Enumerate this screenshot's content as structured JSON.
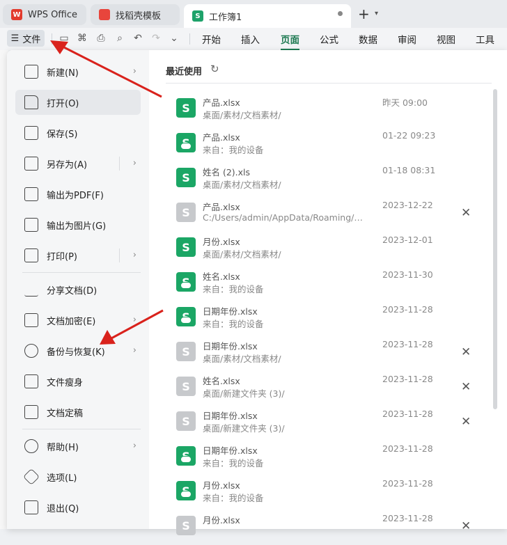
{
  "tabs": [
    {
      "label": "WPS Office",
      "icon": "wps-logo-icon"
    },
    {
      "label": "找稻壳模板",
      "icon": "template-icon"
    },
    {
      "label": "工作簿1",
      "icon": "spreadsheet-s-icon"
    }
  ],
  "toolbar": {
    "file_label": "文件",
    "menus": [
      "开始",
      "插入",
      "页面",
      "公式",
      "数据",
      "审阅",
      "视图",
      "工具"
    ],
    "active_menu": "页面"
  },
  "file_menu": [
    {
      "label": "新建(N)",
      "icon": "new-doc-icon",
      "submenu": true
    },
    {
      "label": "打开(O)",
      "icon": "folder-icon",
      "submenu": false,
      "highlighted": true
    },
    {
      "label": "保存(S)",
      "icon": "save-icon",
      "submenu": false
    },
    {
      "label": "另存为(A)",
      "icon": "save-as-icon",
      "submenu": true
    },
    {
      "label": "输出为PDF(F)",
      "icon": "pdf-icon",
      "submenu": false
    },
    {
      "label": "输出为图片(G)",
      "icon": "image-icon",
      "submenu": false
    },
    {
      "label": "打印(P)",
      "icon": "print-icon",
      "submenu": true
    },
    {
      "label": "分享文档(D)",
      "icon": "share-icon",
      "submenu": false
    },
    {
      "label": "文档加密(E)",
      "icon": "encrypt-icon",
      "submenu": true
    },
    {
      "label": "备份与恢复(K)",
      "icon": "backup-icon",
      "submenu": true
    },
    {
      "label": "文件瘦身",
      "icon": "slim-icon",
      "submenu": false
    },
    {
      "label": "文档定稿",
      "icon": "finalize-icon",
      "submenu": false
    },
    {
      "label": "帮助(H)",
      "icon": "help-icon",
      "submenu": true
    },
    {
      "label": "选项(L)",
      "icon": "options-icon",
      "submenu": false
    },
    {
      "label": "退出(Q)",
      "icon": "exit-icon",
      "submenu": false
    }
  ],
  "recent": {
    "title": "最近使用",
    "items": [
      {
        "name": "产品.xlsx",
        "path": "桌面/素材/文档素材/",
        "time": "昨天  09:00",
        "icon": "green",
        "cloud": false,
        "closable": false
      },
      {
        "name": "产品.xlsx",
        "path": "来自：我的设备",
        "time": "01-22 09:23",
        "icon": "green",
        "cloud": true,
        "closable": false
      },
      {
        "name": "姓名 (2).xls",
        "path": "桌面/素材/文档素材/",
        "time": "01-18 08:31",
        "icon": "green",
        "cloud": false,
        "closable": false
      },
      {
        "name": "产品.xlsx",
        "path": "C:/Users/admin/AppData/Roaming/Wo...",
        "time": "2023-12-22",
        "icon": "gray",
        "cloud": false,
        "closable": true
      },
      {
        "name": "月份.xlsx",
        "path": "桌面/素材/文档素材/",
        "time": "2023-12-01",
        "icon": "green",
        "cloud": false,
        "closable": false
      },
      {
        "name": "姓名.xlsx",
        "path": "来自：我的设备",
        "time": "2023-11-30",
        "icon": "green",
        "cloud": true,
        "closable": false
      },
      {
        "name": "日期年份.xlsx",
        "path": "来自：我的设备",
        "time": "2023-11-28",
        "icon": "green",
        "cloud": true,
        "closable": false
      },
      {
        "name": "日期年份.xlsx",
        "path": "桌面/素材/文档素材/",
        "time": "2023-11-28",
        "icon": "gray",
        "cloud": false,
        "closable": true
      },
      {
        "name": "姓名.xlsx",
        "path": "桌面/新建文件夹 (3)/",
        "time": "2023-11-28",
        "icon": "gray",
        "cloud": false,
        "closable": true
      },
      {
        "name": "日期年份.xlsx",
        "path": "桌面/新建文件夹 (3)/",
        "time": "2023-11-28",
        "icon": "gray",
        "cloud": false,
        "closable": true
      },
      {
        "name": "日期年份.xlsx",
        "path": "来自：我的设备",
        "time": "2023-11-28",
        "icon": "green",
        "cloud": true,
        "closable": false
      },
      {
        "name": "月份.xlsx",
        "path": "来自：我的设备",
        "time": "2023-11-28",
        "icon": "green",
        "cloud": true,
        "closable": false
      },
      {
        "name": "月份.xlsx",
        "path": "",
        "time": "2023-11-28",
        "icon": "gray",
        "cloud": false,
        "closable": true
      }
    ]
  },
  "colors": {
    "accent": "#1e7a52",
    "file_green": "#1ba665",
    "annotation_arrow": "#d9221c"
  }
}
